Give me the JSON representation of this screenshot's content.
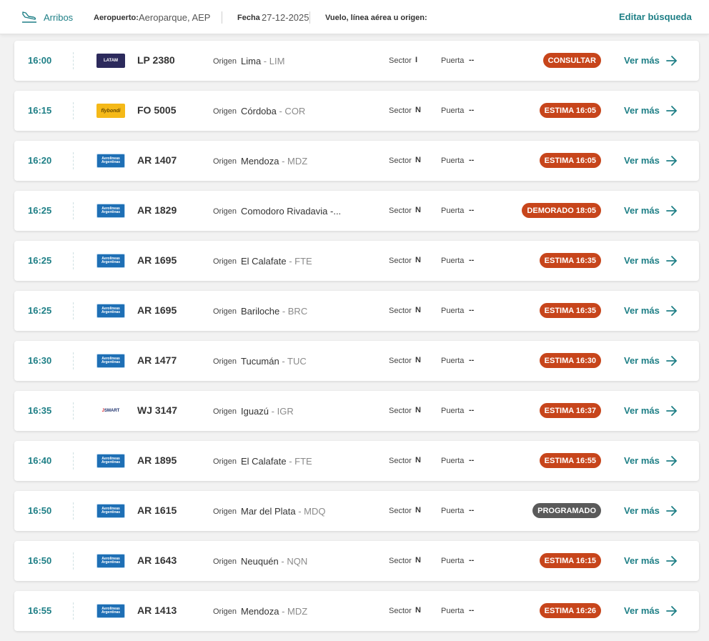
{
  "header": {
    "arrivals_label": "Arribos",
    "airport_key": "Aeropuerto:",
    "airport_value": "Aeroparque, AEP",
    "date_key": "Fecha",
    "date_value": "27-12-2025",
    "search_key": "Vuelo, línea aérea u origen:",
    "edit_label": "Editar búsqueda"
  },
  "labels": {
    "origin": "Origen",
    "sector": "Sector",
    "gate": "Puerta",
    "more": "Ver más"
  },
  "colors": {
    "accent": "#1e7f86",
    "status_orange": "#c7451b",
    "status_gray": "#5a5a5a"
  },
  "flights": [
    {
      "time": "16:00",
      "airline": "latam",
      "logo_text": "LATAM",
      "flight": "LP 2380",
      "city": "Lima",
      "code": " - LIM",
      "sector": "I",
      "gate": "--",
      "status": "CONSULTAR",
      "status_color": "#c7451b"
    },
    {
      "time": "16:15",
      "airline": "flybondi",
      "logo_text": "flybondi",
      "flight": "FO 5005",
      "city": "Córdoba",
      "code": " - COR",
      "sector": "N",
      "gate": "--",
      "status": "ESTIMA 16:05",
      "status_color": "#c7451b"
    },
    {
      "time": "16:20",
      "airline": "aerolineas",
      "logo_text": "Aerolíneas Argentinas",
      "flight": "AR 1407",
      "city": "Mendoza",
      "code": " - MDZ",
      "sector": "N",
      "gate": "--",
      "status": "ESTIMA 16:05",
      "status_color": "#c7451b"
    },
    {
      "time": "16:25",
      "airline": "aerolineas",
      "logo_text": "Aerolíneas Argentinas",
      "flight": "AR 1829",
      "city": "Comodoro Rivadavia -...",
      "code": "",
      "sector": "N",
      "gate": "--",
      "status": "DEMORADO 18:05",
      "status_color": "#c7451b"
    },
    {
      "time": "16:25",
      "airline": "aerolineas",
      "logo_text": "Aerolíneas Argentinas",
      "flight": "AR 1695",
      "city": "El Calafate",
      "code": " - FTE",
      "sector": "N",
      "gate": "--",
      "status": "ESTIMA 16:35",
      "status_color": "#c7451b"
    },
    {
      "time": "16:25",
      "airline": "aerolineas",
      "logo_text": "Aerolíneas Argentinas",
      "flight": "AR 1695",
      "city": "Bariloche",
      "code": " - BRC",
      "sector": "N",
      "gate": "--",
      "status": "ESTIMA 16:35",
      "status_color": "#c7451b"
    },
    {
      "time": "16:30",
      "airline": "aerolineas",
      "logo_text": "Aerolíneas Argentinas",
      "flight": "AR 1477",
      "city": "Tucumán",
      "code": " - TUC",
      "sector": "N",
      "gate": "--",
      "status": "ESTIMA 16:30",
      "status_color": "#c7451b"
    },
    {
      "time": "16:35",
      "airline": "jetsmart",
      "logo_text": "JetSMART",
      "flight": "WJ 3147",
      "city": "Iguazú",
      "code": " - IGR",
      "sector": "N",
      "gate": "--",
      "status": "ESTIMA 16:37",
      "status_color": "#c7451b"
    },
    {
      "time": "16:40",
      "airline": "aerolineas",
      "logo_text": "Aerolíneas Argentinas",
      "flight": "AR 1895",
      "city": "El Calafate",
      "code": " - FTE",
      "sector": "N",
      "gate": "--",
      "status": "ESTIMA 16:55",
      "status_color": "#c7451b"
    },
    {
      "time": "16:50",
      "airline": "aerolineas",
      "logo_text": "Aerolíneas Argentinas",
      "flight": "AR 1615",
      "city": "Mar del Plata",
      "code": " - MDQ",
      "sector": "N",
      "gate": "--",
      "status": "PROGRAMADO",
      "status_color": "#5a5a5a"
    },
    {
      "time": "16:50",
      "airline": "aerolineas",
      "logo_text": "Aerolíneas Argentinas",
      "flight": "AR 1643",
      "city": "Neuquén",
      "code": " - NQN",
      "sector": "N",
      "gate": "--",
      "status": "ESTIMA 16:15",
      "status_color": "#c7451b"
    },
    {
      "time": "16:55",
      "airline": "aerolineas",
      "logo_text": "Aerolíneas Argentinas",
      "flight": "AR 1413",
      "city": "Mendoza",
      "code": " - MDZ",
      "sector": "N",
      "gate": "--",
      "status": "ESTIMA 16:26",
      "status_color": "#c7451b"
    }
  ]
}
